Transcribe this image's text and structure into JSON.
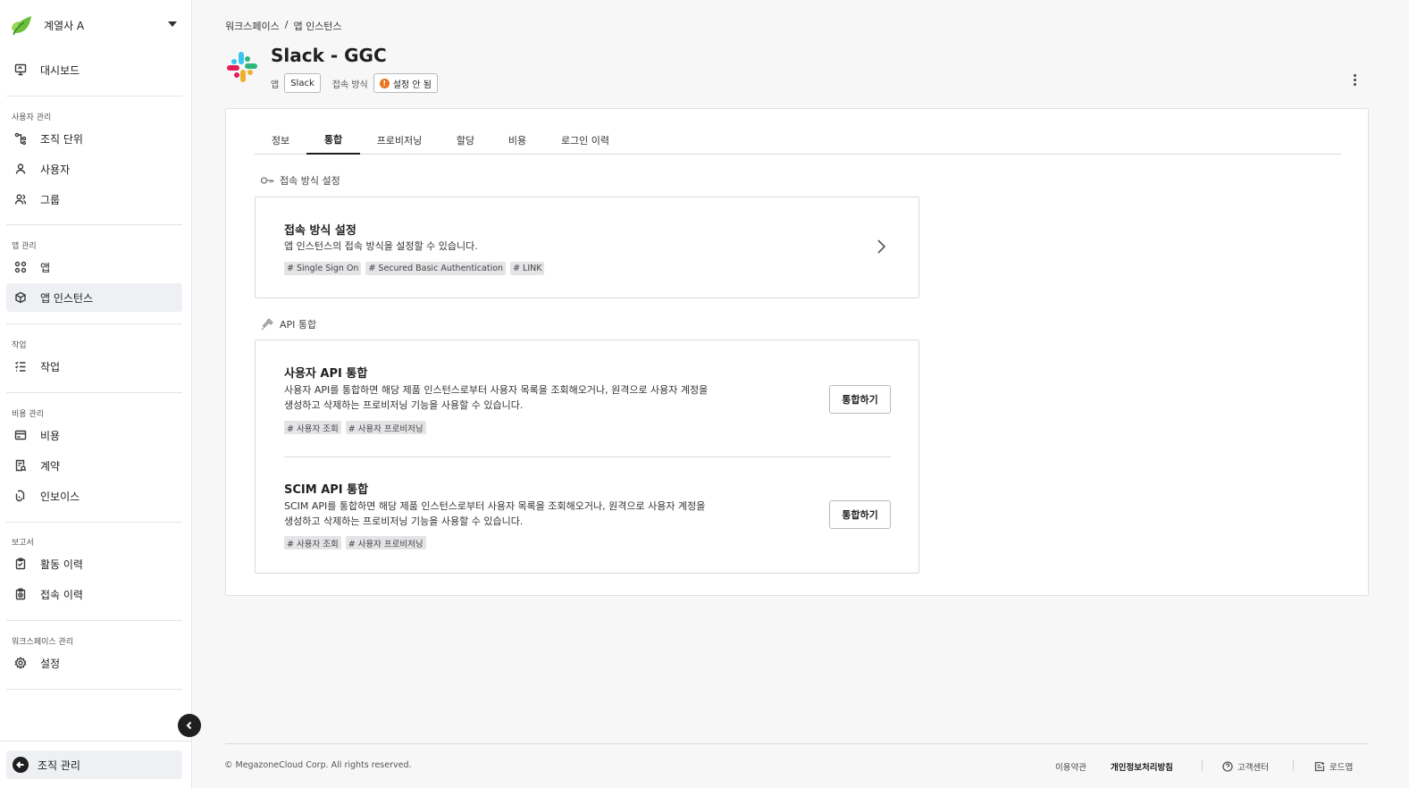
{
  "workspace": {
    "name": "계열사 A"
  },
  "sidebar": {
    "dashboard": "대시보드",
    "sections": {
      "users": "사용자 관리",
      "apps": "앱 관리",
      "tasks": "작업",
      "costs": "비용 관리",
      "reports": "보고서",
      "workspace": "워크스페이스 관리"
    },
    "items": {
      "org_units": "조직 단위",
      "users": "사용자",
      "groups": "그룹",
      "apps": "앱",
      "app_instances": "앱 인스턴스",
      "tasks": "작업",
      "costs": "비용",
      "contracts": "계약",
      "invoices": "인보이스",
      "activity_log": "활동 이력",
      "access_log": "접속 이력",
      "settings": "설정"
    },
    "org_manage": "조직 관리"
  },
  "breadcrumb": {
    "root": "워크스페이스",
    "sep": "/",
    "current": "앱 인스턴스"
  },
  "header": {
    "title": "Slack - GGC",
    "app_label": "앱",
    "app_value": "Slack",
    "access_label": "접속 방식",
    "access_status": "설정 안 됨",
    "access_status_color": "#e8741e"
  },
  "tabs": [
    "정보",
    "통합",
    "프로비저닝",
    "할당",
    "비용",
    "로그인 이력"
  ],
  "active_tab": "통합",
  "access_section": {
    "heading": "접속 방식 설정",
    "card_title": "접속 방식 설정",
    "card_desc": "앱 인스턴스의 접속 방식을 설정할 수 있습니다.",
    "chips": [
      "# Single Sign On",
      "# Secured Basic Authentication",
      "# LINK"
    ]
  },
  "api_section": {
    "heading": "API 통합",
    "user_api": {
      "title": "사용자 API 통합",
      "desc": "사용자 API를 통합하면 해당 제품 인스턴스로부터 사용자 목록을 조회해오거나, 원격으로 사용자 계정을 생성하고 삭제하는 프로비저닝 기능을 사용할 수 있습니다.",
      "chips": [
        "# 사용자 조회",
        "# 사용자 프로비저닝"
      ],
      "button": "통합하기"
    },
    "scim_api": {
      "title": "SCIM API 통합",
      "desc": "SCIM API를 통합하면 해당 제품 인스턴스로부터 사용자 목록을 조회해오거나, 원격으로 사용자 계정을 생성하고 삭제하는 프로비저닝 기능을 사용할 수 있습니다.",
      "chips": [
        "# 사용자 조회",
        "# 사용자 프로비저닝"
      ],
      "button": "통합하기"
    }
  },
  "footer": {
    "copyright": "© MegazoneCloud Corp. All rights reserved.",
    "terms": "이용약관",
    "privacy": "개인정보처리방침",
    "support": "고객센터",
    "roadmap": "로드맵"
  }
}
